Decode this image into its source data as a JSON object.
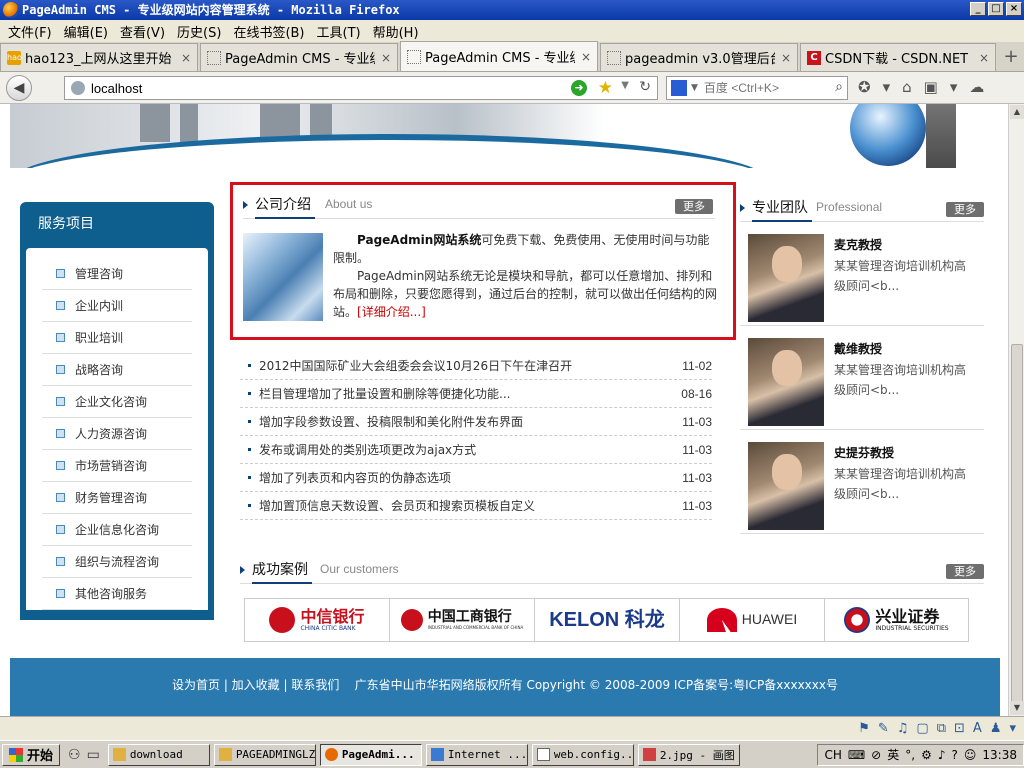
{
  "window": {
    "title": "PageAdmin CMS - 专业级网站内容管理系统 - Mozilla Firefox",
    "controls": [
      "_",
      "□",
      "×"
    ]
  },
  "menu": [
    "文件(F)",
    "编辑(E)",
    "查看(V)",
    "历史(S)",
    "在线书签(B)",
    "工具(T)",
    "帮助(H)"
  ],
  "tabs": [
    {
      "label": "hao123_上网从这里开始",
      "icon": "hao"
    },
    {
      "label": "PageAdmin CMS - 专业级...",
      "icon": "blank"
    },
    {
      "label": "PageAdmin CMS - 专业级...",
      "icon": "blank",
      "active": true
    },
    {
      "label": "pageadmin v3.0管理后台",
      "icon": "blank"
    },
    {
      "label": "CSDN下载 - CSDN.NET",
      "icon": "csdn"
    }
  ],
  "tab_close": "×",
  "tab_new": "+",
  "nav": {
    "url": "localhost",
    "search_placeholder": "百度 <Ctrl+K>",
    "search_logo": "🐾"
  },
  "sidebar": {
    "title": "服务项目",
    "items": [
      "管理咨询",
      "企业内训",
      "职业培训",
      "战略咨询",
      "企业文化咨询",
      "人力资源咨询",
      "市场营销咨询",
      "财务管理咨询",
      "企业信息化咨询",
      "组织与流程咨询",
      "其他咨询服务"
    ]
  },
  "about": {
    "title": "公司介绍",
    "subtitle": "About us",
    "more": "更多",
    "brand": "PageAdmin网站系统",
    "p1": "可免费下载、免费使用、无使用时间与功能 限制。",
    "p2": "PageAdmin网站系统无论是模块和导航，都可以任意增加、排列和布局和删除，只要您愿得到，通过后台的控制，就可以做出任何结构的网站。",
    "link": "[详细介绍...]"
  },
  "news": [
    {
      "title": "2012中国国际矿业大会组委会会议10月26日下午在津召开",
      "date": "11-02"
    },
    {
      "title": "栏目管理增加了批量设置和删除等便捷化功能...",
      "date": "08-16"
    },
    {
      "title": "增加字段参数设置、投稿限制和美化附件发布界面",
      "date": "11-03"
    },
    {
      "title": "发布或调用处的类别选项更改为ajax方式",
      "date": "11-03"
    },
    {
      "title": "增加了列表页和内容页的伪静态选项",
      "date": "11-03"
    },
    {
      "title": "增加置顶信息天数设置、会员页和搜索页模板自定义",
      "date": "11-03"
    }
  ],
  "team": {
    "title": "专业团队",
    "subtitle": "Professional",
    "more": "更多",
    "members": [
      {
        "name": "麦克教授",
        "desc": "某某管理咨询培训机构高级顾问<b..."
      },
      {
        "name": "戴维教授",
        "desc": "某某管理咨询培训机构高级顾问<b..."
      },
      {
        "name": "史提芬教授",
        "desc": "某某管理咨询培训机构高级顾问<b..."
      }
    ]
  },
  "cases": {
    "title": "成功案例",
    "subtitle": "Our customers",
    "more": "更多",
    "logos": [
      {
        "main": "中信银行",
        "sub": "CHINA CITIC BANK",
        "color": "#c8101c"
      },
      {
        "main": "中国工商银行",
        "sub": "INDUSTRIAL AND COMMERCIAL BANK OF CHINA",
        "color": "#c8101c"
      },
      {
        "main": "KELON 科龙",
        "sub": "",
        "color": "#1a3a8a"
      },
      {
        "main": "HUAWEI",
        "sub": "",
        "color": "#d6001c"
      },
      {
        "main": "兴业证券",
        "sub": "INDUSTRIAL SECURITIES",
        "color": "#111111"
      }
    ]
  },
  "footer": {
    "links": "设为首页 | 加入收藏 | 联系我们",
    "copyright": "广东省中山市华拓网络版权所有 Copyright © 2008-2009  ICP备案号:粤ICP备xxxxxxx号"
  },
  "taskbar": {
    "start": "开始",
    "tasks": [
      {
        "label": "download"
      },
      {
        "label": "PAGEADMINGLZX"
      },
      {
        "label": "PageAdmi...",
        "active": true
      },
      {
        "label": "Internet ..."
      },
      {
        "label": "web.config..."
      },
      {
        "label": "2.jpg - 画图"
      }
    ],
    "lang": "CH",
    "ime": "英",
    "time": "13:38"
  },
  "colors": {
    "accent": "#0e5e8e",
    "highlight": "#d4101c",
    "footer": "#2a7ab0"
  }
}
